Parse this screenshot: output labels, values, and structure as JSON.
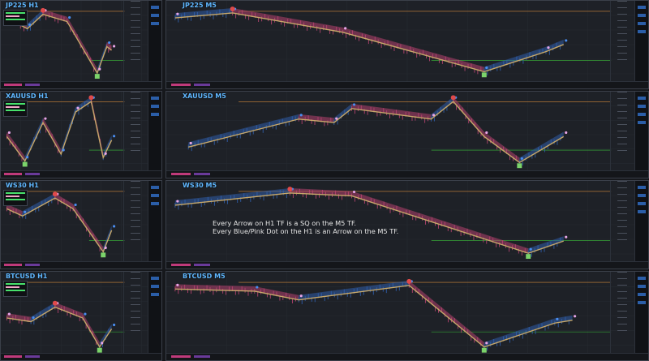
{
  "charts": [
    {
      "id": "jp225-h1",
      "title": "JP225 H1",
      "timeframe": "H1"
    },
    {
      "id": "jp225-m5",
      "title": "JP225 M5",
      "timeframe": "M5"
    },
    {
      "id": "xauusd-h1",
      "title": "XAUUSD H1",
      "timeframe": "H1"
    },
    {
      "id": "xauusd-m5",
      "title": "XAUUSD M5",
      "timeframe": "M5"
    },
    {
      "id": "ws30-h1",
      "title": "WS30 H1",
      "timeframe": "H1"
    },
    {
      "id": "ws30-m5",
      "title": "WS30 M5",
      "timeframe": "M5"
    },
    {
      "id": "btcusd-h1",
      "title": "BTCUSD H1",
      "timeframe": "H1"
    },
    {
      "id": "btcusd-m5",
      "title": "BTCUSD M5",
      "timeframe": "M5"
    }
  ],
  "annotation": {
    "line1": "Every Arrow on H1 TF is a SQ on the M5 TF.",
    "line2": "Every Blue/Pink Dot on the H1 is an Arrow on the M5 TF."
  },
  "colors": {
    "background": "#1e2127",
    "title": "#5fb7ff",
    "zigzag": "#c7a86a",
    "ribbon_bear": "#b2426e",
    "ribbon_bull": "#2f5da8",
    "dot_blue": "#4a8df0",
    "dot_pink": "#e8a6e8",
    "arrow_up": "#7bd36a",
    "arrow_down": "#e04a4a",
    "level_orange": "#d38a3a",
    "level_green": "#3bbf3b"
  },
  "icons": [
    "up-arrow-icon",
    "down-arrow-icon",
    "blue-dot-icon",
    "pink-dot-icon"
  ]
}
